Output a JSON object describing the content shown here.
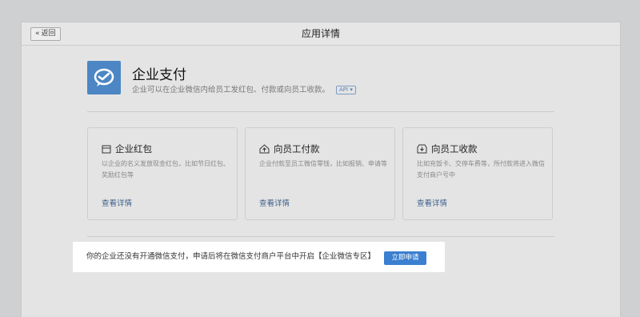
{
  "topbar": {
    "back_label": "返回",
    "title": "应用详情"
  },
  "app": {
    "name": "企业支付",
    "description": "企业可以在企业微信内给员工发红包、付款或向员工收款。",
    "api_tag": "API"
  },
  "cards": [
    {
      "icon": "wallet-icon",
      "title": "企业红包",
      "description": "以企业的名义发放现金红包，比如节日红包、奖励红包等",
      "link": "查看详情"
    },
    {
      "icon": "house-up-icon",
      "title": "向员工付款",
      "description": "企业付款至员工微信零钱，比如报销、申请等",
      "link": "查看详情"
    },
    {
      "icon": "download-box-icon",
      "title": "向员工收款",
      "description": "比如充饭卡、交停车费等，所付款将进入微信支付商户号中",
      "link": "查看详情"
    }
  ],
  "notice": {
    "text": "你的企业还没有开通微信支付，申请后将在微信支付商户平台中开启【企业微信专区】",
    "button": "立即申请"
  },
  "colors": {
    "app_icon_bg": "#4c86c4",
    "link": "#3e5f8c",
    "primary_button": "#3a7fd0"
  }
}
